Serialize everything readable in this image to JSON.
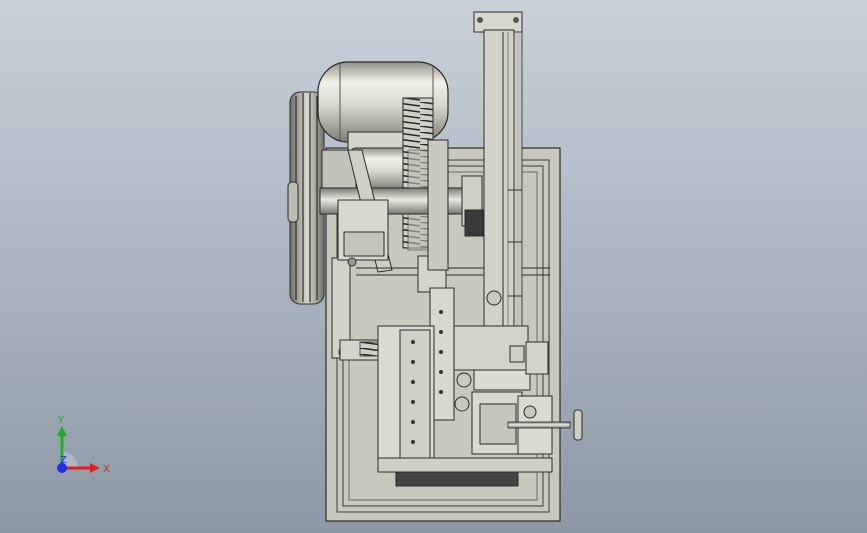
{
  "viewport": {
    "background_top": "#c9d0d8",
    "background_bottom": "#8d98a7"
  },
  "model": {
    "metal_light": "#dfe0d6",
    "metal_mid": "#c6c7bb",
    "metal_dark": "#8e8f85",
    "edge_color": "#2b2b2b"
  },
  "triad": {
    "x_label": "X",
    "y_label": "Y",
    "z_label": "Z",
    "x_color": "#e02020",
    "y_color": "#20b020",
    "z_color": "#2030e0",
    "icon": "coordinate-triad-icon"
  }
}
